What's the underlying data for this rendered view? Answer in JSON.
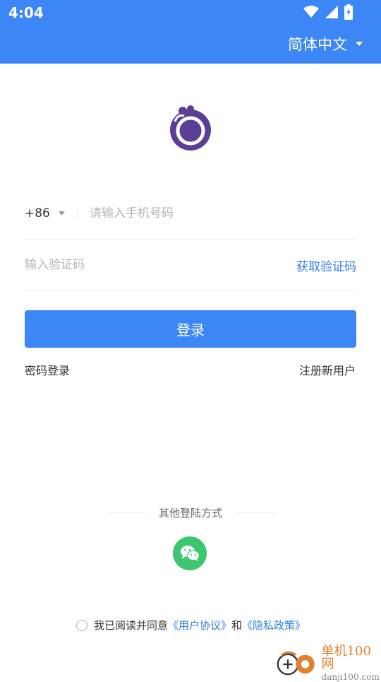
{
  "status_bar": {
    "time": "4:04",
    "icons": [
      "wifi-icon",
      "signal-icon",
      "battery-charging-icon"
    ]
  },
  "header": {
    "language_label": "简体中文",
    "language_icon": "caret-down-icon"
  },
  "logo": {
    "icon": "app-logo"
  },
  "form": {
    "country_code": "+86",
    "phone_placeholder": "请输入手机号码",
    "code_placeholder": "输入验证码",
    "get_code_label": "获取验证码",
    "login_label": "登录",
    "password_login_label": "密码登录",
    "register_label": "注册新用户"
  },
  "other_login": {
    "title": "其他登陆方式",
    "methods": [
      "wechat-icon"
    ]
  },
  "agreement": {
    "prefix": "我已阅读并同意",
    "user_agreement": "《用户协议》",
    "and": "和",
    "privacy_policy": "《隐私政策》"
  },
  "watermark": {
    "cn": "单机100网",
    "en": "danji100.com"
  },
  "colors": {
    "primary": "#3d86f5",
    "link": "#2f7de6",
    "wechat": "#3cc66f",
    "logo_purple": "#5b3e96",
    "watermark_orange": "#e08030"
  }
}
